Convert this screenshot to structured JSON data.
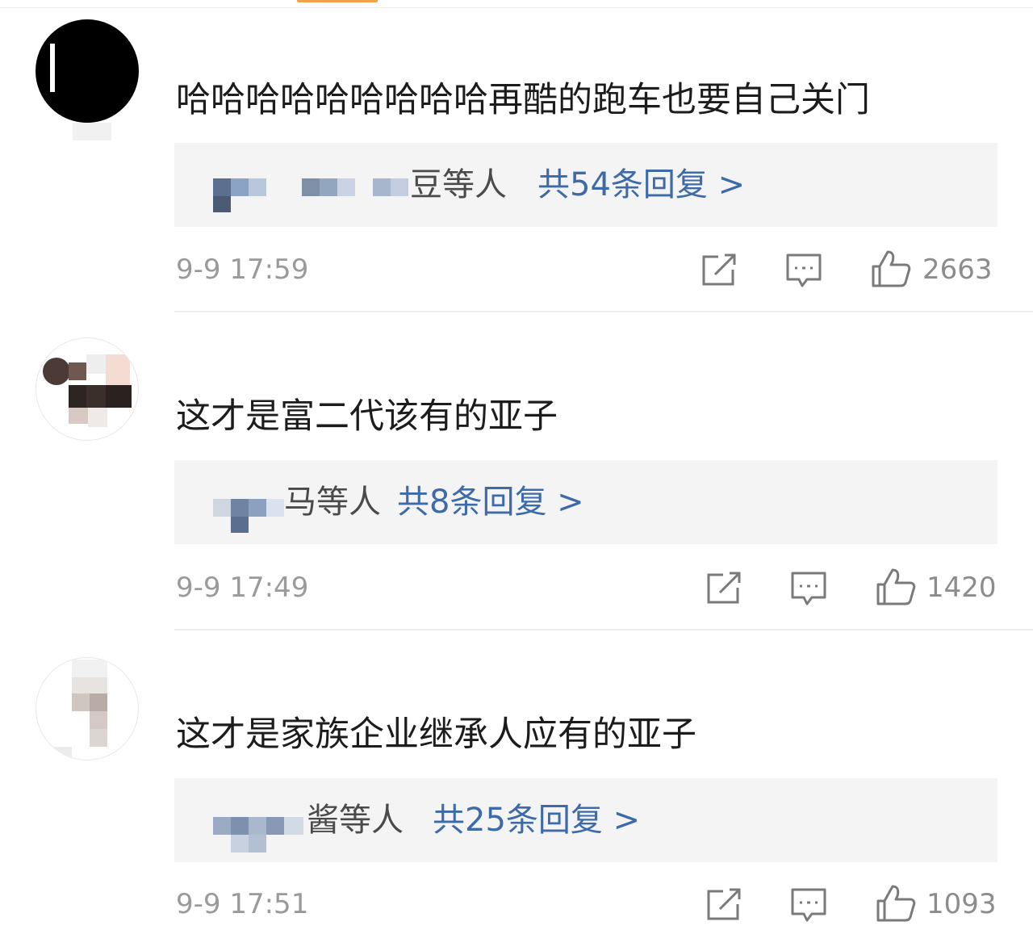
{
  "comments": [
    {
      "text": "哈哈哈哈哈哈哈哈哈再酷的跑车也要自己关门",
      "reply_names_tail": "豆等人",
      "reply_link": "共54条回复 >",
      "timestamp": "9-9 17:59",
      "likes": "2663"
    },
    {
      "text": "这才是富二代该有的亚子",
      "reply_names_tail": "马等人",
      "reply_link": "共8条回复 >",
      "timestamp": "9-9 17:49",
      "likes": "1420"
    },
    {
      "text": "这才是家族企业继承人应有的亚子",
      "reply_names_tail": "酱等人",
      "reply_link": "共25条回复 >",
      "timestamp": "9-9 17:51",
      "likes": "1093"
    }
  ],
  "icons": {
    "share": "share-icon",
    "comment": "comment-icon",
    "like": "thumbs-up-icon"
  },
  "colors": {
    "link": "#3d6aa8",
    "timestamp": "#9a9a9a",
    "reply_box_bg": "#f4f4f5",
    "accent_tab": "#f2a14a"
  }
}
